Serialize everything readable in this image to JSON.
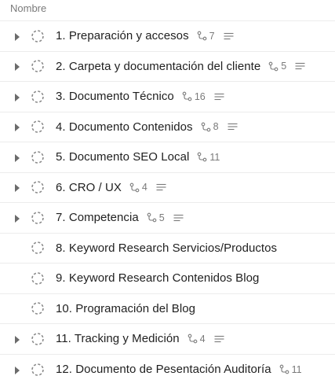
{
  "header": {
    "column_label": "Nombre"
  },
  "rows": [
    {
      "title": "1. Preparación y accesos",
      "subtasks": "7",
      "has_caret": true,
      "has_description": true
    },
    {
      "title": "2. Carpeta y documentación del cliente",
      "subtasks": "5",
      "has_caret": true,
      "has_description": true
    },
    {
      "title": "3. Documento Técnico",
      "subtasks": "16",
      "has_caret": true,
      "has_description": true
    },
    {
      "title": "4. Documento Contenidos",
      "subtasks": "8",
      "has_caret": true,
      "has_description": true
    },
    {
      "title": "5. Documento SEO Local",
      "subtasks": "11",
      "has_caret": true,
      "has_description": false
    },
    {
      "title": "6. CRO / UX",
      "subtasks": "4",
      "has_caret": true,
      "has_description": true
    },
    {
      "title": "7. Competencia",
      "subtasks": "5",
      "has_caret": true,
      "has_description": true
    },
    {
      "title": "8. Keyword Research Servicios/Productos",
      "subtasks": null,
      "has_caret": false,
      "has_description": false
    },
    {
      "title": "9. Keyword Research Contenidos Blog",
      "subtasks": null,
      "has_caret": false,
      "has_description": false
    },
    {
      "title": "10. Programación del Blog",
      "subtasks": null,
      "has_caret": false,
      "has_description": false
    },
    {
      "title": "11. Tracking y Medición",
      "subtasks": "4",
      "has_caret": true,
      "has_description": true
    },
    {
      "title": "12. Documento de Pesentación Auditoría",
      "subtasks": "11",
      "has_caret": true,
      "has_description": false
    }
  ],
  "icons": {
    "caret": "caret-right-icon",
    "status": "dashed-circle-status-icon",
    "subtask": "subtask-branch-icon",
    "description": "description-lines-icon"
  },
  "colors": {
    "caret": "#6b6b6b",
    "status": "#8a8a8a",
    "meta": "#7a7a7a",
    "divider": "#ececec"
  }
}
